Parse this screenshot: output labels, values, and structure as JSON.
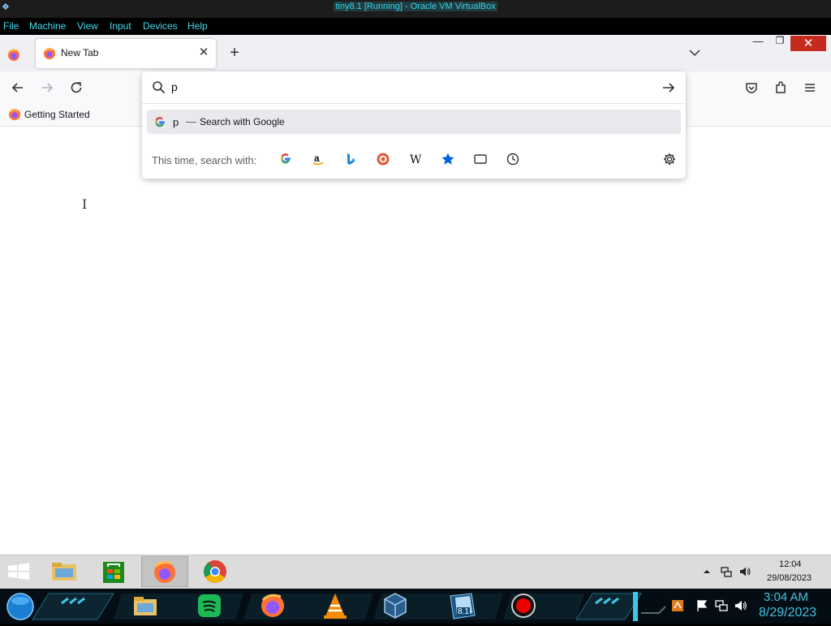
{
  "vbox": {
    "title": "tiny8.1 [Running] - Oracle VM VirtualBox",
    "menu": [
      "File",
      "Machine",
      "View",
      "Input",
      "Devices",
      "Help"
    ]
  },
  "browser": {
    "tab_title": "New Tab",
    "urlbar": {
      "value": "p",
      "suggestion_query": "p",
      "suggestion_dash": "—",
      "suggestion_action": "Search with Google",
      "one_off_label": "This time, search with:",
      "one_off_engines": [
        "google-icon",
        "amazon-icon",
        "bing-icon",
        "duckduckgo-icon",
        "wikipedia-icon",
        "bookmarks-icon",
        "tabs-icon",
        "history-icon"
      ]
    },
    "bookmarks": [
      {
        "label": "Getting Started"
      }
    ]
  },
  "guest_taskbar": {
    "apps": [
      "start-icon",
      "file-explorer-icon",
      "store-icon",
      "firefox-icon",
      "chrome-icon"
    ],
    "clock_time": "12:04",
    "clock_date": "29/08/2023"
  },
  "host_dock": {
    "clock_time": "3:04 AM",
    "clock_date": "8/29/2023",
    "badge": "8.1"
  },
  "colors": {
    "vbox_text": "#46d8ec",
    "close_red": "#c42b1c",
    "suggestion_bg": "#e8e8ed"
  }
}
